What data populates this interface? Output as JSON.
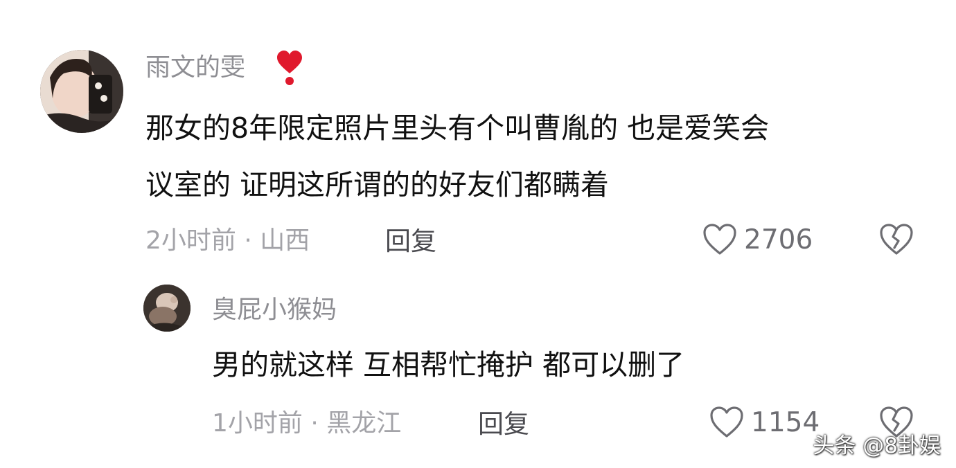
{
  "comments": [
    {
      "username": "雨文的雯",
      "badge_icon": "heart-exclamation-emoji",
      "text_line1": "那女的8年限定照片里头有个叫曹胤的 也是爱笑会",
      "text_line2": "议室的  证明这所谓的的好友们都瞒着",
      "meta": "2小时前 · 山西",
      "reply_label": "回复",
      "like_count": "2706"
    }
  ],
  "replies": [
    {
      "username": "臭屁小猴妈",
      "text": "男的就这样 互相帮忙掩护 都可以删了",
      "meta": "1小时前 · 黑龙江",
      "reply_label": "回复",
      "like_count": "1154"
    }
  ],
  "watermark": "头条 @8卦娱",
  "colors": {
    "background": "#ffffff",
    "username": "#8e8e93",
    "text": "#111111",
    "meta": "#a3a3a8",
    "heart_emoji": "#e0192d"
  }
}
